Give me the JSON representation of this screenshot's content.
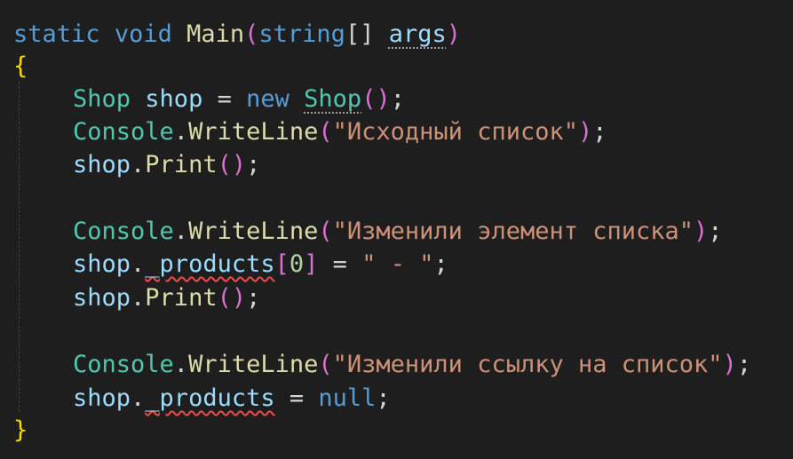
{
  "code": {
    "line1": {
      "kw_static": "static",
      "kw_void": "void",
      "method": "Main",
      "open_paren": "(",
      "param_type": "string",
      "brackets": "[]",
      "param_name": "args",
      "close_paren": ")"
    },
    "line2": {
      "open_brace": "{"
    },
    "line3": {
      "type": "Shop",
      "var": "shop",
      "assign": " = ",
      "kw_new": "new",
      "ctor": "Shop",
      "parens": "()",
      "semi": ";"
    },
    "line4": {
      "cls": "Console",
      "dot": ".",
      "method": "WriteLine",
      "open": "(",
      "str": "\"Исходный список\"",
      "close": ")",
      "semi": ";"
    },
    "line5": {
      "var": "shop",
      "dot": ".",
      "method": "Print",
      "parens": "()",
      "semi": ";"
    },
    "line7": {
      "cls": "Console",
      "dot": ".",
      "method": "WriteLine",
      "open": "(",
      "str": "\"Изменили элемент списка\"",
      "close": ")",
      "semi": ";"
    },
    "line8": {
      "var": "shop",
      "dot": ".",
      "field": "_products",
      "open_br": "[",
      "index": "0",
      "close_br": "]",
      "assign": " = ",
      "str": "\" - \"",
      "semi": ";"
    },
    "line9": {
      "var": "shop",
      "dot": ".",
      "method": "Print",
      "parens": "()",
      "semi": ";"
    },
    "line11": {
      "cls": "Console",
      "dot": ".",
      "method": "WriteLine",
      "open": "(",
      "str": "\"Изменили ссылку на список\"",
      "close": ")",
      "semi": ";"
    },
    "line12": {
      "var": "shop",
      "dot": ".",
      "field": "_products",
      "assign": " = ",
      "kw_null": "null",
      "semi": ";"
    },
    "line13": {
      "close_brace": "}"
    }
  },
  "colors": {
    "background": "#1e1e1e",
    "keyword": "#569cd6",
    "type": "#4ec9b0",
    "method": "#dcdcaa",
    "variable": "#9cdcfe",
    "string": "#ce9178",
    "number": "#b5cea8",
    "error_squiggle": "#f14c4c"
  }
}
